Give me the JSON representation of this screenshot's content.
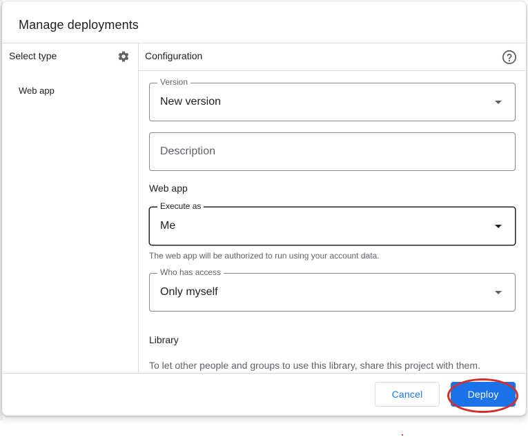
{
  "dialog": {
    "title": "Manage deployments"
  },
  "type_panel": {
    "header": "Select type",
    "settings_icon": "gear-icon",
    "items": [
      {
        "label": "Web app"
      }
    ]
  },
  "config_panel": {
    "header": "Configuration",
    "help_icon": "help-circle-icon",
    "version": {
      "label": "Version",
      "value": "New version"
    },
    "description": {
      "placeholder": "Description"
    },
    "web_app": {
      "title": "Web app",
      "execute_as": {
        "label": "Execute as",
        "value": "Me"
      },
      "hint": "The web app will be authorized to run using your account data.",
      "who_has_access": {
        "label": "Who has access",
        "value": "Only myself"
      }
    },
    "library": {
      "title": "Library",
      "text": "To let other people and groups to use this library, share this project with them."
    }
  },
  "footer": {
    "cancel_label": "Cancel",
    "deploy_label": "Deploy"
  },
  "colors": {
    "accent": "#1a73e8",
    "divider": "#dadce0",
    "highlight": "#d32f2f"
  }
}
